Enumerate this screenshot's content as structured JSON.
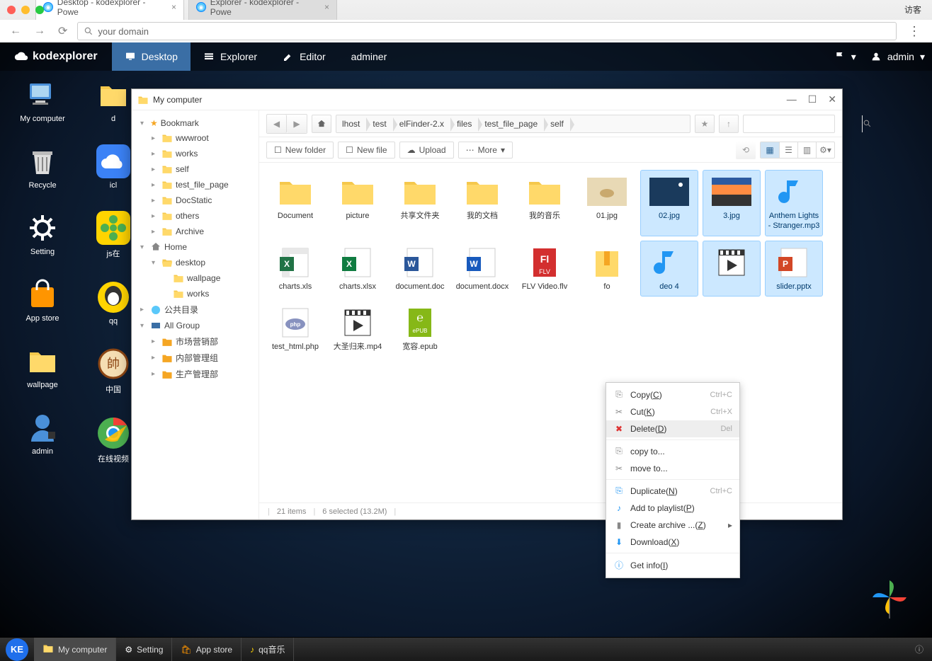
{
  "browser": {
    "tabs": [
      {
        "title": "Desktop - kodexplorer - Powe",
        "active": true
      },
      {
        "title": "Explorer - kodexplorer - Powe",
        "active": false
      }
    ],
    "guest": "访客",
    "address": "your domain"
  },
  "menubar": {
    "brand": "kodexplorer",
    "items": [
      {
        "label": "Desktop",
        "icon": "desktop",
        "active": true
      },
      {
        "label": "Explorer",
        "icon": "explorer"
      },
      {
        "label": "Editor",
        "icon": "editor"
      },
      {
        "label": "adminer",
        "icon": null
      }
    ],
    "user": "admin"
  },
  "desktop_icons_col1": [
    {
      "label": "My computer",
      "icon": "computer"
    },
    {
      "label": "Recycle",
      "icon": "recycle"
    },
    {
      "label": "Setting",
      "icon": "gear"
    },
    {
      "label": "App store",
      "icon": "bag"
    },
    {
      "label": "wallpage",
      "icon": "folder"
    },
    {
      "label": "admin",
      "icon": "user"
    }
  ],
  "desktop_icons_col2": [
    {
      "label": "d",
      "icon": "folder"
    },
    {
      "label": "icl",
      "icon": "icloud"
    },
    {
      "label": "js在",
      "icon": "flower"
    },
    {
      "label": "qq",
      "icon": "qq"
    },
    {
      "label": "中国",
      "icon": "xiangqi"
    },
    {
      "label": "在线视频",
      "icon": "chrome"
    }
  ],
  "explorer": {
    "title": "My computer",
    "tree": {
      "bookmark": "Bookmark",
      "bookmark_items": [
        "wwwroot",
        "works",
        "self",
        "test_file_page",
        "DocStatic",
        "others",
        "Archive"
      ],
      "home": "Home",
      "home_items": {
        "desktop": "desktop",
        "desktop_children": [
          "wallpage",
          "works"
        ]
      },
      "public": "公共目录",
      "allgroup": "All Group",
      "allgroup_items": [
        "市场营销部",
        "内部管理组",
        "生产管理部"
      ]
    },
    "breadcrumbs": [
      "lhost",
      "test",
      "elFinder-2.x",
      "files",
      "test_file_page",
      "self"
    ],
    "toolbar": {
      "newfolder": "New folder",
      "newfile": "New file",
      "upload": "Upload",
      "more": "More"
    },
    "files": [
      {
        "name": "Document",
        "type": "folder"
      },
      {
        "name": "picture",
        "type": "folder"
      },
      {
        "name": "共享文件夹",
        "type": "folder"
      },
      {
        "name": "我的文档",
        "type": "folder"
      },
      {
        "name": "我的音乐",
        "type": "folder"
      },
      {
        "name": "01.jpg",
        "type": "image1"
      },
      {
        "name": "02.jpg",
        "type": "image2",
        "selected": true
      },
      {
        "name": "3.jpg",
        "type": "image3",
        "selected": true
      },
      {
        "name": "Anthem Lights - Stranger.mp3",
        "type": "music",
        "selected": true
      },
      {
        "name": "charts.xls",
        "type": "xls"
      },
      {
        "name": "charts.xlsx",
        "type": "xlsx"
      },
      {
        "name": "document.doc",
        "type": "doc"
      },
      {
        "name": "document.docx",
        "type": "docx"
      },
      {
        "name": "FLV Video.flv",
        "type": "flv"
      },
      {
        "name": "fo",
        "type": "zip"
      },
      {
        "name": "deo 4",
        "type": "video",
        "selected": true
      },
      {
        "name": "",
        "type": "video2",
        "selected": true
      },
      {
        "name": "slider.pptx",
        "type": "pptx",
        "selected": true
      },
      {
        "name": "test_html.php",
        "type": "php"
      },
      {
        "name": "大圣归来.mp4",
        "type": "mp4"
      },
      {
        "name": "宽容.epub",
        "type": "epub"
      }
    ],
    "status": {
      "items": "21 items",
      "selected": "6 selected (13.2M)"
    }
  },
  "context_menu": [
    {
      "label": "Copy",
      "key": "C",
      "shortcut": "Ctrl+C",
      "icon": "copy"
    },
    {
      "label": "Cut",
      "key": "K",
      "shortcut": "Ctrl+X",
      "icon": "cut"
    },
    {
      "label": "Delete",
      "key": "D",
      "shortcut": "Del",
      "icon": "delete",
      "hover": true
    },
    {
      "sep": true
    },
    {
      "label": "copy to...",
      "icon": "copy"
    },
    {
      "label": "move to...",
      "icon": "cut"
    },
    {
      "sep": true
    },
    {
      "label": "Duplicate",
      "key": "N",
      "shortcut": "Ctrl+C",
      "icon": "duplicate"
    },
    {
      "label": "Add to playlist",
      "key": "P",
      "icon": "playlist"
    },
    {
      "label": "Create archive ...",
      "key": "Z",
      "icon": "archive",
      "submenu": true
    },
    {
      "label": "Download",
      "key": "X",
      "icon": "download"
    },
    {
      "sep": true
    },
    {
      "label": "Get info",
      "key": "I",
      "icon": "info"
    }
  ],
  "taskbar": {
    "start": "KE",
    "items": [
      {
        "label": "My computer",
        "active": true,
        "icon": "folder"
      },
      {
        "label": "Setting",
        "icon": "gear"
      },
      {
        "label": "App store",
        "icon": "bag"
      },
      {
        "label": "qq音乐",
        "icon": "qqmusic"
      }
    ]
  }
}
